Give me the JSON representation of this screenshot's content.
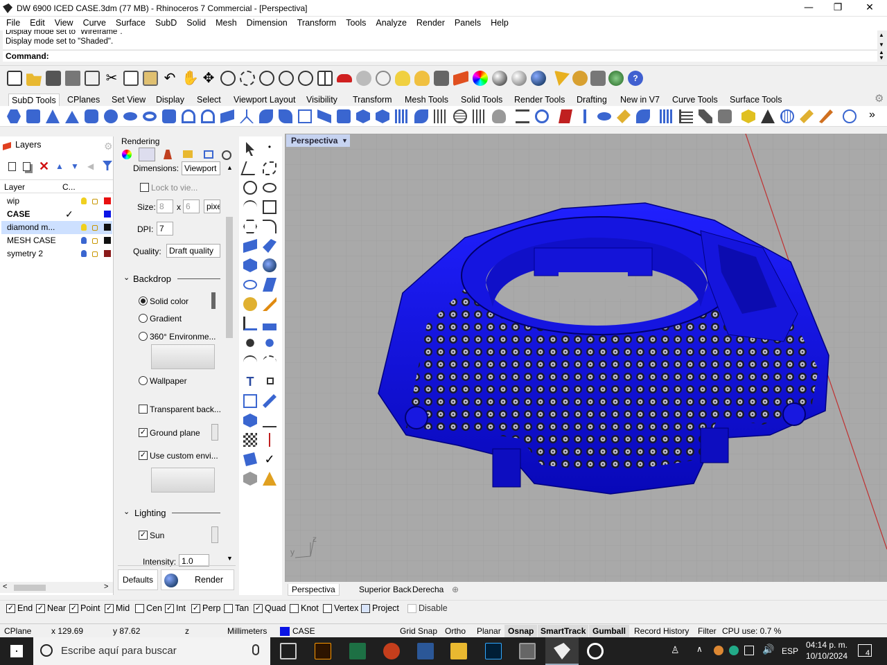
{
  "window": {
    "title": "DW 6900 ICED CASE.3dm (77 MB) - Rhinoceros 7 Commercial - [Perspectiva]",
    "minimize": "—",
    "maximize": "❐",
    "close": "✕"
  },
  "menu": [
    "File",
    "Edit",
    "View",
    "Curve",
    "Surface",
    "SubD",
    "Solid",
    "Mesh",
    "Dimension",
    "Transform",
    "Tools",
    "Analyze",
    "Render",
    "Panels",
    "Help"
  ],
  "command": {
    "history_line1": "Display mode set to \"Wireframe\".",
    "history_line2": "Display mode set to \"Shaded\".",
    "prompt": "Command:"
  },
  "toolbar_tabs": [
    "SubD Tools",
    "CPlanes",
    "Set View",
    "Display",
    "Select",
    "Viewport Layout",
    "Visibility",
    "Transform",
    "Mesh Tools",
    "Solid Tools",
    "Render Tools",
    "Drafting",
    "New in V7",
    "Curve Tools",
    "Surface Tools"
  ],
  "layers_panel": {
    "tab_label": "Layers",
    "col_layer": "Layer",
    "col_current": "C...",
    "rows": [
      {
        "name": "wip",
        "color": "#e81010",
        "current": false,
        "selected": false
      },
      {
        "name": "CASE",
        "color": "#0a14e6",
        "current": true,
        "selected": false
      },
      {
        "name": "diamond m...",
        "color": "#111111",
        "current": false,
        "selected": true
      },
      {
        "name": "MESH CASE",
        "color": "#111111",
        "current": false,
        "selected": false
      },
      {
        "name": "symetry 2",
        "color": "#8a1a1a",
        "current": false,
        "selected": false
      }
    ],
    "check_mark": "✓"
  },
  "rendering_panel": {
    "title": "Rendering",
    "dimensions_label": "Dimensions:",
    "dimensions_value": "Viewport",
    "lock_label": "Lock to vie...",
    "size_label": "Size:",
    "size_w": "8",
    "size_x": "x",
    "size_h": "6",
    "size_unit": "pixe",
    "dpi_label": "DPI:",
    "dpi_value": "7",
    "quality_label": "Quality:",
    "quality_value": "Draft quality",
    "backdrop_section": "Backdrop",
    "solid_color": "Solid color",
    "gradient": "Gradient",
    "environment360": "360° Environme...",
    "wallpaper": "Wallpaper",
    "transparent_back": "Transparent back...",
    "ground_plane": "Ground plane",
    "use_custom_env": "Use custom envi...",
    "lighting_section": "Lighting",
    "sun": "Sun",
    "intensity_label": "Intensity:",
    "intensity_value": "1.0",
    "defaults_button": "Defaults",
    "render_button": "Render"
  },
  "viewport": {
    "title": "Perspectiva",
    "tabs": [
      "Perspectiva",
      "Superior",
      "Back",
      "Derecha"
    ],
    "add_tab": "⊕",
    "axis_y": "y",
    "axis_z": "z"
  },
  "osnap": [
    {
      "label": "End",
      "checked": true
    },
    {
      "label": "Near",
      "checked": true
    },
    {
      "label": "Point",
      "checked": true
    },
    {
      "label": "Mid",
      "checked": true
    },
    {
      "label": "Cen",
      "checked": false
    },
    {
      "label": "Int",
      "checked": true
    },
    {
      "label": "Perp",
      "checked": true
    },
    {
      "label": "Tan",
      "checked": false
    },
    {
      "label": "Quad",
      "checked": true
    },
    {
      "label": "Knot",
      "checked": false
    },
    {
      "label": "Vertex",
      "checked": false
    },
    {
      "label": "Project",
      "checked": false
    },
    {
      "label": "Disable",
      "checked": false
    }
  ],
  "status": {
    "cplane": "CPlane",
    "x": "x 129.69",
    "y": "y 87.62",
    "z": "z",
    "units": "Millimeters",
    "layer": "CASE",
    "layer_color": "#0a14e6",
    "grid_snap": "Grid Snap",
    "ortho": "Ortho",
    "planar": "Planar",
    "osnap": "Osnap",
    "smarttrack": "SmartTrack",
    "gumball": "Gumball",
    "record_history": "Record History",
    "filter": "Filter",
    "cpu": "CPU use: 0.7 %"
  },
  "taskbar": {
    "search_placeholder": "Escribe aquí para buscar",
    "lang": "ESP",
    "time": "04:14 p. m.",
    "date": "10/10/2024",
    "notifications": "4"
  },
  "colors": {
    "model_blue": "#1010e8",
    "viewport_bg": "#a8a8a8",
    "active_tab": "#c6d3f0",
    "selected_row": "#cde0ff"
  }
}
